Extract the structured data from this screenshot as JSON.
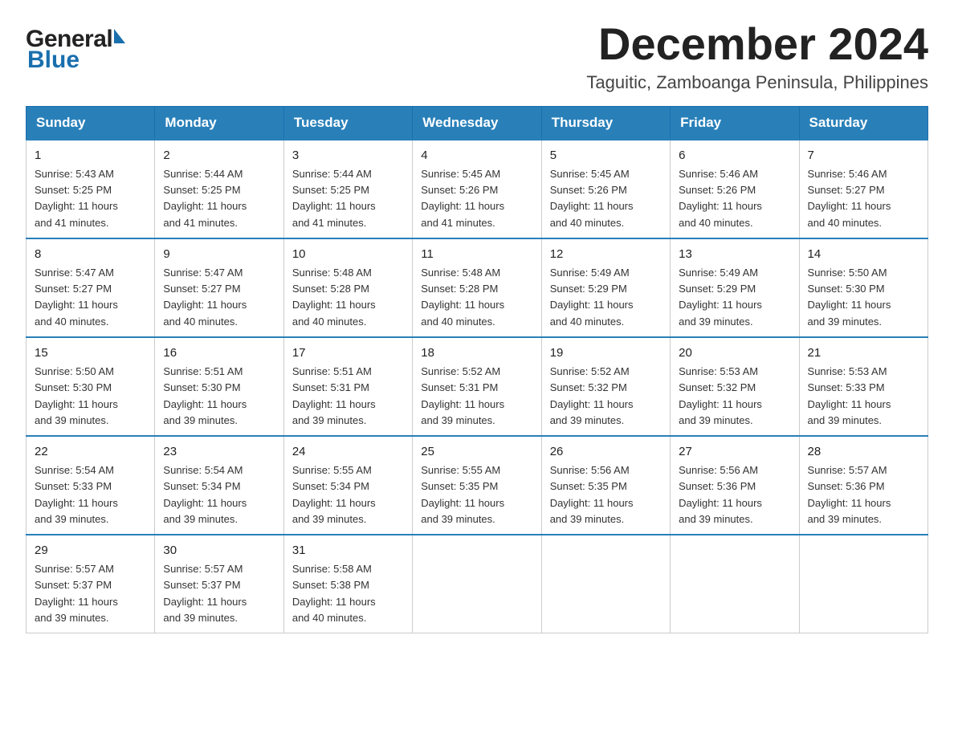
{
  "logo": {
    "general": "General",
    "blue": "Blue"
  },
  "header": {
    "month_year": "December 2024",
    "location": "Taguitic, Zamboanga Peninsula, Philippines"
  },
  "weekdays": [
    "Sunday",
    "Monday",
    "Tuesday",
    "Wednesday",
    "Thursday",
    "Friday",
    "Saturday"
  ],
  "weeks": [
    [
      {
        "day": "1",
        "sunrise": "5:43 AM",
        "sunset": "5:25 PM",
        "daylight": "11 hours and 41 minutes."
      },
      {
        "day": "2",
        "sunrise": "5:44 AM",
        "sunset": "5:25 PM",
        "daylight": "11 hours and 41 minutes."
      },
      {
        "day": "3",
        "sunrise": "5:44 AM",
        "sunset": "5:25 PM",
        "daylight": "11 hours and 41 minutes."
      },
      {
        "day": "4",
        "sunrise": "5:45 AM",
        "sunset": "5:26 PM",
        "daylight": "11 hours and 41 minutes."
      },
      {
        "day": "5",
        "sunrise": "5:45 AM",
        "sunset": "5:26 PM",
        "daylight": "11 hours and 40 minutes."
      },
      {
        "day": "6",
        "sunrise": "5:46 AM",
        "sunset": "5:26 PM",
        "daylight": "11 hours and 40 minutes."
      },
      {
        "day": "7",
        "sunrise": "5:46 AM",
        "sunset": "5:27 PM",
        "daylight": "11 hours and 40 minutes."
      }
    ],
    [
      {
        "day": "8",
        "sunrise": "5:47 AM",
        "sunset": "5:27 PM",
        "daylight": "11 hours and 40 minutes."
      },
      {
        "day": "9",
        "sunrise": "5:47 AM",
        "sunset": "5:27 PM",
        "daylight": "11 hours and 40 minutes."
      },
      {
        "day": "10",
        "sunrise": "5:48 AM",
        "sunset": "5:28 PM",
        "daylight": "11 hours and 40 minutes."
      },
      {
        "day": "11",
        "sunrise": "5:48 AM",
        "sunset": "5:28 PM",
        "daylight": "11 hours and 40 minutes."
      },
      {
        "day": "12",
        "sunrise": "5:49 AM",
        "sunset": "5:29 PM",
        "daylight": "11 hours and 40 minutes."
      },
      {
        "day": "13",
        "sunrise": "5:49 AM",
        "sunset": "5:29 PM",
        "daylight": "11 hours and 39 minutes."
      },
      {
        "day": "14",
        "sunrise": "5:50 AM",
        "sunset": "5:30 PM",
        "daylight": "11 hours and 39 minutes."
      }
    ],
    [
      {
        "day": "15",
        "sunrise": "5:50 AM",
        "sunset": "5:30 PM",
        "daylight": "11 hours and 39 minutes."
      },
      {
        "day": "16",
        "sunrise": "5:51 AM",
        "sunset": "5:30 PM",
        "daylight": "11 hours and 39 minutes."
      },
      {
        "day": "17",
        "sunrise": "5:51 AM",
        "sunset": "5:31 PM",
        "daylight": "11 hours and 39 minutes."
      },
      {
        "day": "18",
        "sunrise": "5:52 AM",
        "sunset": "5:31 PM",
        "daylight": "11 hours and 39 minutes."
      },
      {
        "day": "19",
        "sunrise": "5:52 AM",
        "sunset": "5:32 PM",
        "daylight": "11 hours and 39 minutes."
      },
      {
        "day": "20",
        "sunrise": "5:53 AM",
        "sunset": "5:32 PM",
        "daylight": "11 hours and 39 minutes."
      },
      {
        "day": "21",
        "sunrise": "5:53 AM",
        "sunset": "5:33 PM",
        "daylight": "11 hours and 39 minutes."
      }
    ],
    [
      {
        "day": "22",
        "sunrise": "5:54 AM",
        "sunset": "5:33 PM",
        "daylight": "11 hours and 39 minutes."
      },
      {
        "day": "23",
        "sunrise": "5:54 AM",
        "sunset": "5:34 PM",
        "daylight": "11 hours and 39 minutes."
      },
      {
        "day": "24",
        "sunrise": "5:55 AM",
        "sunset": "5:34 PM",
        "daylight": "11 hours and 39 minutes."
      },
      {
        "day": "25",
        "sunrise": "5:55 AM",
        "sunset": "5:35 PM",
        "daylight": "11 hours and 39 minutes."
      },
      {
        "day": "26",
        "sunrise": "5:56 AM",
        "sunset": "5:35 PM",
        "daylight": "11 hours and 39 minutes."
      },
      {
        "day": "27",
        "sunrise": "5:56 AM",
        "sunset": "5:36 PM",
        "daylight": "11 hours and 39 minutes."
      },
      {
        "day": "28",
        "sunrise": "5:57 AM",
        "sunset": "5:36 PM",
        "daylight": "11 hours and 39 minutes."
      }
    ],
    [
      {
        "day": "29",
        "sunrise": "5:57 AM",
        "sunset": "5:37 PM",
        "daylight": "11 hours and 39 minutes."
      },
      {
        "day": "30",
        "sunrise": "5:57 AM",
        "sunset": "5:37 PM",
        "daylight": "11 hours and 39 minutes."
      },
      {
        "day": "31",
        "sunrise": "5:58 AM",
        "sunset": "5:38 PM",
        "daylight": "11 hours and 40 minutes."
      },
      null,
      null,
      null,
      null
    ]
  ],
  "labels": {
    "sunrise": "Sunrise:",
    "sunset": "Sunset:",
    "daylight": "Daylight:"
  }
}
